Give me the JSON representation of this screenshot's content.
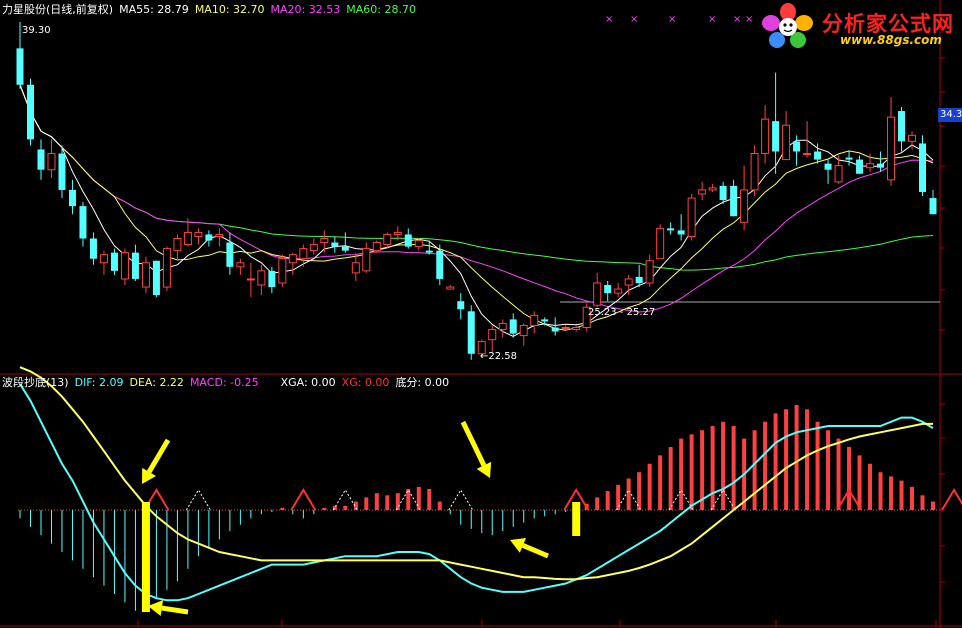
{
  "header": {
    "stock": "力星股份(日线,前复权)",
    "ma5": "MA55: 28.79",
    "ma10": "MA10: 32.70",
    "ma20": "MA20: 32.53",
    "ma60": "MA60: 28.70"
  },
  "logo": {
    "name": "分析家公式网",
    "url": "www.88gs.com"
  },
  "annotations": {
    "high": "39.30",
    "low": "←22.58",
    "range": "25.23 - 25.27",
    "last_price": "34.3"
  },
  "indicator": {
    "title": "波段抄底(13)",
    "dif": "DIF: 2.09",
    "dea": "DEA: 2.22",
    "macd": "MACD: -0.25",
    "xga": "XGA: 0.00",
    "xg": "XG: 0.00",
    "difen": "底分: 0.00"
  },
  "colors": {
    "up": "#ff4040",
    "down": "#54ffff",
    "ma5": "#ffffff",
    "ma10": "#ffff60",
    "ma20": "#ff40ff",
    "ma60": "#40ff40",
    "dif": "#54ffff",
    "dea": "#ffff60",
    "signal": "#ffff00",
    "axis": "#b00000"
  },
  "chart_data": {
    "type": "candlestick",
    "candles": [
      [
        38.0,
        39.3,
        36.0,
        36.2
      ],
      [
        36.2,
        36.5,
        33.2,
        33.5
      ],
      [
        33.0,
        33.5,
        31.5,
        32.0
      ],
      [
        32.0,
        33.5,
        31.6,
        32.8
      ],
      [
        32.8,
        33.2,
        30.6,
        31.0
      ],
      [
        31.0,
        31.5,
        29.8,
        30.2
      ],
      [
        30.2,
        30.4,
        28.2,
        28.6
      ],
      [
        28.6,
        28.9,
        27.3,
        27.6
      ],
      [
        27.4,
        28.0,
        26.8,
        27.8
      ],
      [
        27.9,
        28.1,
        26.8,
        27.0
      ],
      [
        26.6,
        28.1,
        26.3,
        27.9
      ],
      [
        27.9,
        28.3,
        26.5,
        26.6
      ],
      [
        26.2,
        27.7,
        25.9,
        27.4
      ],
      [
        27.5,
        27.5,
        25.7,
        25.8
      ],
      [
        26.2,
        28.2,
        26.0,
        28.1
      ],
      [
        28.0,
        28.8,
        27.5,
        28.6
      ],
      [
        28.3,
        29.6,
        28.2,
        28.9
      ],
      [
        28.7,
        29.1,
        28.3,
        28.9
      ],
      [
        28.8,
        29.0,
        28.2,
        28.5
      ],
      [
        28.7,
        29.1,
        28.2,
        28.8
      ],
      [
        28.4,
        28.9,
        26.8,
        27.2
      ],
      [
        27.2,
        27.6,
        26.8,
        27.4
      ],
      [
        26.6,
        27.4,
        25.7,
        26.6
      ],
      [
        26.3,
        27.3,
        25.8,
        27.0
      ],
      [
        27.0,
        27.2,
        25.9,
        26.2
      ],
      [
        26.4,
        27.8,
        26.2,
        27.6
      ],
      [
        27.4,
        27.9,
        26.8,
        27.8
      ],
      [
        27.6,
        28.3,
        27.2,
        28.1
      ],
      [
        28.0,
        28.6,
        27.8,
        28.3
      ],
      [
        28.4,
        29.0,
        27.9,
        28.6
      ],
      [
        28.4,
        28.7,
        27.9,
        28.2
      ],
      [
        28.2,
        28.9,
        27.9,
        28.0
      ],
      [
        26.9,
        27.9,
        26.5,
        27.4
      ],
      [
        27.0,
        28.4,
        26.9,
        28.1
      ],
      [
        28.0,
        28.5,
        27.9,
        28.4
      ],
      [
        28.3,
        28.9,
        28.1,
        28.8
      ],
      [
        28.8,
        29.2,
        28.5,
        28.9
      ],
      [
        28.8,
        29.1,
        28.1,
        28.2
      ],
      [
        28.2,
        28.6,
        28.0,
        28.5
      ],
      [
        28.0,
        28.5,
        27.8,
        27.9
      ],
      [
        28.0,
        28.3,
        26.3,
        26.6
      ],
      [
        26.1,
        26.3,
        26.1,
        26.2
      ],
      [
        25.5,
        25.9,
        24.6,
        25.1
      ],
      [
        25.0,
        25.3,
        22.6,
        22.9
      ],
      [
        22.9,
        23.6,
        22.7,
        23.5
      ],
      [
        23.6,
        24.3,
        23.0,
        24.1
      ],
      [
        24.1,
        24.6,
        23.7,
        24.4
      ],
      [
        24.6,
        24.9,
        23.7,
        23.9
      ],
      [
        23.8,
        24.4,
        23.3,
        24.3
      ],
      [
        24.3,
        25.0,
        23.9,
        24.8
      ],
      [
        24.6,
        24.7,
        24.3,
        24.5
      ],
      [
        24.2,
        24.7,
        23.8,
        24.0
      ],
      [
        24.2,
        24.3,
        24.1,
        24.2
      ],
      [
        24.1,
        24.3,
        24.0,
        24.2
      ],
      [
        24.2,
        25.4,
        24.0,
        25.2
      ],
      [
        25.3,
        26.9,
        25.2,
        26.4
      ],
      [
        26.3,
        26.5,
        25.5,
        25.9
      ],
      [
        25.9,
        26.4,
        25.7,
        26.1
      ],
      [
        26.3,
        26.8,
        25.8,
        26.6
      ],
      [
        26.7,
        27.3,
        26.2,
        26.4
      ],
      [
        26.4,
        27.8,
        26.2,
        27.5
      ],
      [
        27.6,
        29.3,
        27.6,
        29.1
      ],
      [
        29.1,
        29.4,
        28.8,
        29.0
      ],
      [
        29.0,
        29.8,
        28.5,
        28.8
      ],
      [
        28.7,
        30.8,
        28.5,
        30.6
      ],
      [
        30.8,
        31.4,
        30.5,
        31.0
      ],
      [
        31.0,
        31.3,
        30.9,
        31.1
      ],
      [
        31.2,
        31.4,
        30.3,
        30.5
      ],
      [
        31.2,
        31.5,
        29.7,
        29.7
      ],
      [
        29.4,
        32.2,
        29.0,
        31.0
      ],
      [
        31.0,
        33.2,
        30.7,
        32.8
      ],
      [
        32.8,
        35.2,
        32.3,
        34.5
      ],
      [
        34.4,
        36.8,
        31.8,
        32.9
      ],
      [
        32.5,
        34.9,
        32.5,
        34.2
      ],
      [
        33.4,
        33.7,
        32.2,
        32.9
      ],
      [
        32.8,
        34.4,
        32.6,
        32.8
      ],
      [
        32.9,
        33.3,
        32.3,
        32.5
      ],
      [
        32.3,
        32.5,
        31.3,
        32.0
      ],
      [
        31.4,
        32.7,
        31.3,
        32.2
      ],
      [
        32.6,
        32.9,
        32.2,
        32.5
      ],
      [
        32.5,
        32.7,
        31.8,
        31.8
      ],
      [
        32.1,
        32.8,
        31.9,
        32.3
      ],
      [
        32.3,
        32.9,
        31.9,
        32.1
      ],
      [
        31.5,
        35.6,
        31.2,
        34.6
      ],
      [
        34.9,
        35.1,
        32.9,
        33.4
      ],
      [
        33.4,
        33.9,
        33.0,
        33.7
      ],
      [
        33.3,
        33.7,
        30.7,
        30.9
      ],
      [
        30.6,
        31.0,
        29.8,
        29.8
      ]
    ],
    "macd_bars": [
      -0.2,
      -0.4,
      -0.6,
      -0.8,
      -1.0,
      -1.2,
      -1.4,
      -1.6,
      -1.8,
      -2.0,
      -2.2,
      -2.4,
      -2.2,
      -2.1,
      -1.9,
      -1.7,
      -1.4,
      -1.1,
      -0.9,
      -0.7,
      -0.5,
      -0.35,
      -0.2,
      -0.1,
      -0.05,
      0.05,
      -0.1,
      -0.2,
      -0.1,
      0.05,
      0.1,
      0.1,
      0.2,
      0.3,
      0.4,
      0.35,
      0.4,
      0.5,
      0.55,
      0.5,
      0.2,
      -0.1,
      -0.35,
      -0.45,
      -0.55,
      -0.6,
      -0.5,
      -0.4,
      -0.3,
      -0.2,
      -0.15,
      -0.1,
      -0.05,
      0.05,
      0.15,
      0.3,
      0.45,
      0.6,
      0.75,
      0.9,
      1.1,
      1.3,
      1.5,
      1.7,
      1.8,
      1.9,
      2.0,
      2.1,
      2.0,
      1.7,
      1.9,
      2.1,
      2.3,
      2.4,
      2.5,
      2.4,
      2.1,
      1.9,
      1.7,
      1.5,
      1.3,
      1.1,
      0.9,
      0.8,
      0.7,
      0.55,
      0.35,
      0.2
    ],
    "dif": [
      3.0,
      2.6,
      2.1,
      1.6,
      1.1,
      0.7,
      0.2,
      -0.3,
      -0.7,
      -1.1,
      -1.5,
      -1.8,
      -2.0,
      -2.1,
      -2.15,
      -2.15,
      -2.1,
      -2.0,
      -1.9,
      -1.8,
      -1.7,
      -1.6,
      -1.5,
      -1.4,
      -1.3,
      -1.3,
      -1.3,
      -1.3,
      -1.25,
      -1.2,
      -1.15,
      -1.1,
      -1.1,
      -1.1,
      -1.1,
      -1.05,
      -1.0,
      -1.0,
      -1.0,
      -1.05,
      -1.2,
      -1.4,
      -1.6,
      -1.75,
      -1.85,
      -1.9,
      -1.95,
      -1.95,
      -1.95,
      -1.9,
      -1.85,
      -1.8,
      -1.75,
      -1.65,
      -1.55,
      -1.4,
      -1.25,
      -1.1,
      -0.95,
      -0.8,
      -0.65,
      -0.5,
      -0.3,
      -0.1,
      0.1,
      0.25,
      0.4,
      0.5,
      0.65,
      0.85,
      1.1,
      1.35,
      1.6,
      1.75,
      1.85,
      1.9,
      1.95,
      2.0,
      2.0,
      2.0,
      2.0,
      2.0,
      2.0,
      2.1,
      2.2,
      2.2,
      2.1,
      1.95
    ],
    "dea": [
      3.4,
      3.3,
      3.15,
      2.95,
      2.7,
      2.4,
      2.1,
      1.75,
      1.4,
      1.05,
      0.7,
      0.4,
      0.1,
      -0.15,
      -0.35,
      -0.55,
      -0.7,
      -0.8,
      -0.9,
      -1.0,
      -1.05,
      -1.1,
      -1.15,
      -1.2,
      -1.2,
      -1.2,
      -1.2,
      -1.2,
      -1.2,
      -1.2,
      -1.2,
      -1.2,
      -1.2,
      -1.2,
      -1.2,
      -1.2,
      -1.2,
      -1.2,
      -1.2,
      -1.2,
      -1.2,
      -1.25,
      -1.3,
      -1.35,
      -1.4,
      -1.45,
      -1.5,
      -1.55,
      -1.6,
      -1.6,
      -1.62,
      -1.64,
      -1.65,
      -1.65,
      -1.62,
      -1.6,
      -1.55,
      -1.5,
      -1.45,
      -1.38,
      -1.3,
      -1.2,
      -1.1,
      -0.95,
      -0.8,
      -0.6,
      -0.4,
      -0.2,
      0.0,
      0.2,
      0.4,
      0.6,
      0.8,
      1.0,
      1.15,
      1.3,
      1.42,
      1.52,
      1.6,
      1.68,
      1.75,
      1.8,
      1.85,
      1.9,
      1.95,
      2.0,
      2.05,
      2.05
    ],
    "signals": [
      12,
      53
    ],
    "peaks": [
      13,
      17,
      27,
      31,
      37,
      42,
      53,
      58,
      63,
      67,
      79,
      89
    ]
  }
}
